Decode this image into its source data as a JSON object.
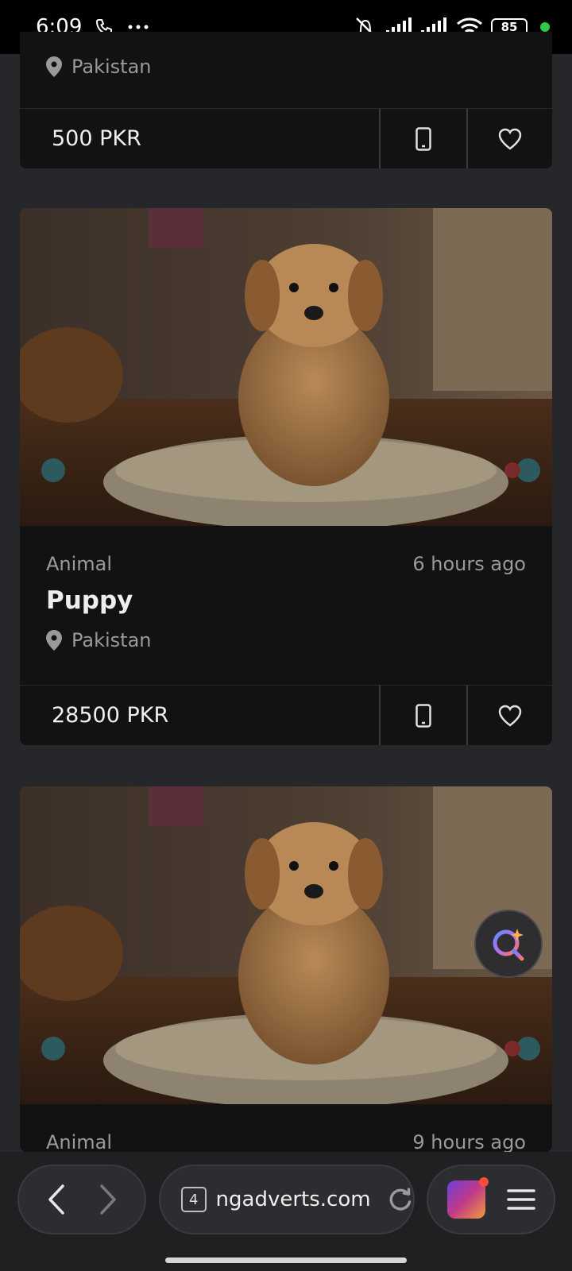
{
  "status_bar": {
    "time": "6:09",
    "battery": "85"
  },
  "listings": [
    {
      "location": "Pakistan",
      "price": "500 PKR"
    },
    {
      "category": "Animal",
      "posted": "6 hours ago",
      "title": "Puppy",
      "location": "Pakistan",
      "price": "28500 PKR"
    },
    {
      "category": "Animal",
      "posted": "9 hours ago"
    }
  ],
  "browser": {
    "tab_count": "4",
    "url": "ngadverts.com"
  },
  "colors": {
    "background": "#26272a",
    "card": "#121212",
    "muted_text": "#9a9a9a",
    "status_green": "#2ecc40"
  }
}
